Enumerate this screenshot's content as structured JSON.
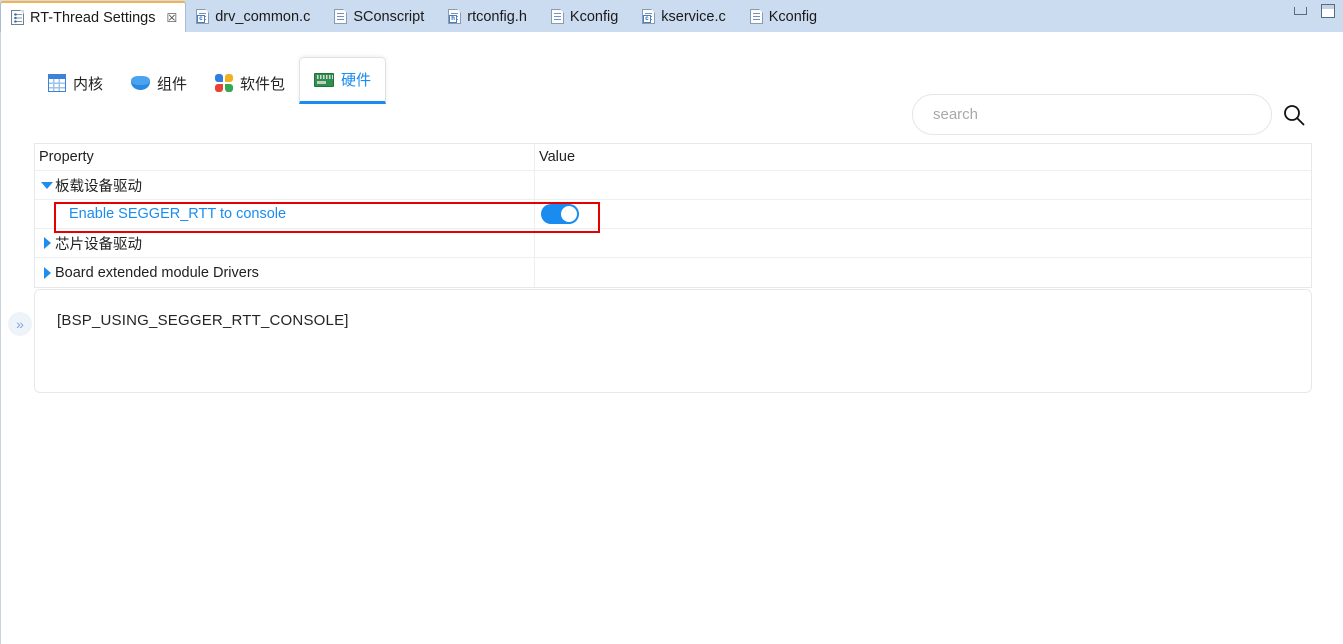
{
  "window": {
    "minimize_label": "Minimize",
    "maximize_label": "Maximize"
  },
  "editor_tabs": [
    {
      "label": "RT-Thread Settings",
      "icon": "settings-icon",
      "active": true,
      "closable": true,
      "close_glyph": "☒"
    },
    {
      "label": "drv_common.c",
      "icon": "c-file-icon",
      "badge": "c",
      "active": false
    },
    {
      "label": "SConscript",
      "icon": "file-icon",
      "badge": "",
      "active": false
    },
    {
      "label": "rtconfig.h",
      "icon": "h-file-icon",
      "badge": "h",
      "active": false
    },
    {
      "label": "Kconfig",
      "icon": "file-icon",
      "badge": "",
      "active": false
    },
    {
      "label": "kservice.c",
      "icon": "c-file-icon",
      "badge": "c",
      "active": false
    },
    {
      "label": "Kconfig",
      "icon": "file-icon",
      "badge": "",
      "active": false
    }
  ],
  "category_tabs": [
    {
      "label": "内核",
      "icon": "kernel-icon",
      "active": false
    },
    {
      "label": "组件",
      "icon": "components-icon",
      "active": false
    },
    {
      "label": "软件包",
      "icon": "packages-icon",
      "active": false
    },
    {
      "label": "硬件",
      "icon": "hardware-icon",
      "active": true
    }
  ],
  "search": {
    "placeholder": "search",
    "value": "",
    "icon": "search-icon"
  },
  "table": {
    "columns": [
      "Property",
      "Value"
    ],
    "rows": [
      {
        "property": "板载设备驱动",
        "value": "",
        "state": "expanded",
        "arrow": "triangle-down",
        "indent": 0,
        "style": "normal"
      },
      {
        "property": "Enable SEGGER_RTT to console",
        "value": "on",
        "state": "leaf",
        "arrow": "none",
        "indent": 1,
        "style": "link",
        "control": "toggle",
        "highlighted": true
      },
      {
        "property": "芯片设备驱动",
        "value": "",
        "state": "collapsed",
        "arrow": "triangle-right",
        "indent": 0,
        "style": "normal"
      },
      {
        "property": "Board extended module Drivers",
        "value": "",
        "state": "collapsed",
        "arrow": "triangle-right",
        "indent": 0,
        "style": "normal"
      }
    ]
  },
  "description": {
    "text": "[BSP_USING_SEGGER_RTT_CONSOLE]",
    "expander_glyph": "»",
    "expander_name": "expand-panel-handle"
  },
  "colors": {
    "accent": "#1a8cf0",
    "tabbar_bg": "#ccdcf0",
    "active_tab_top": "#f5b24a",
    "highlight_border": "#e60000",
    "toggle_on": "#1a8cf0"
  }
}
